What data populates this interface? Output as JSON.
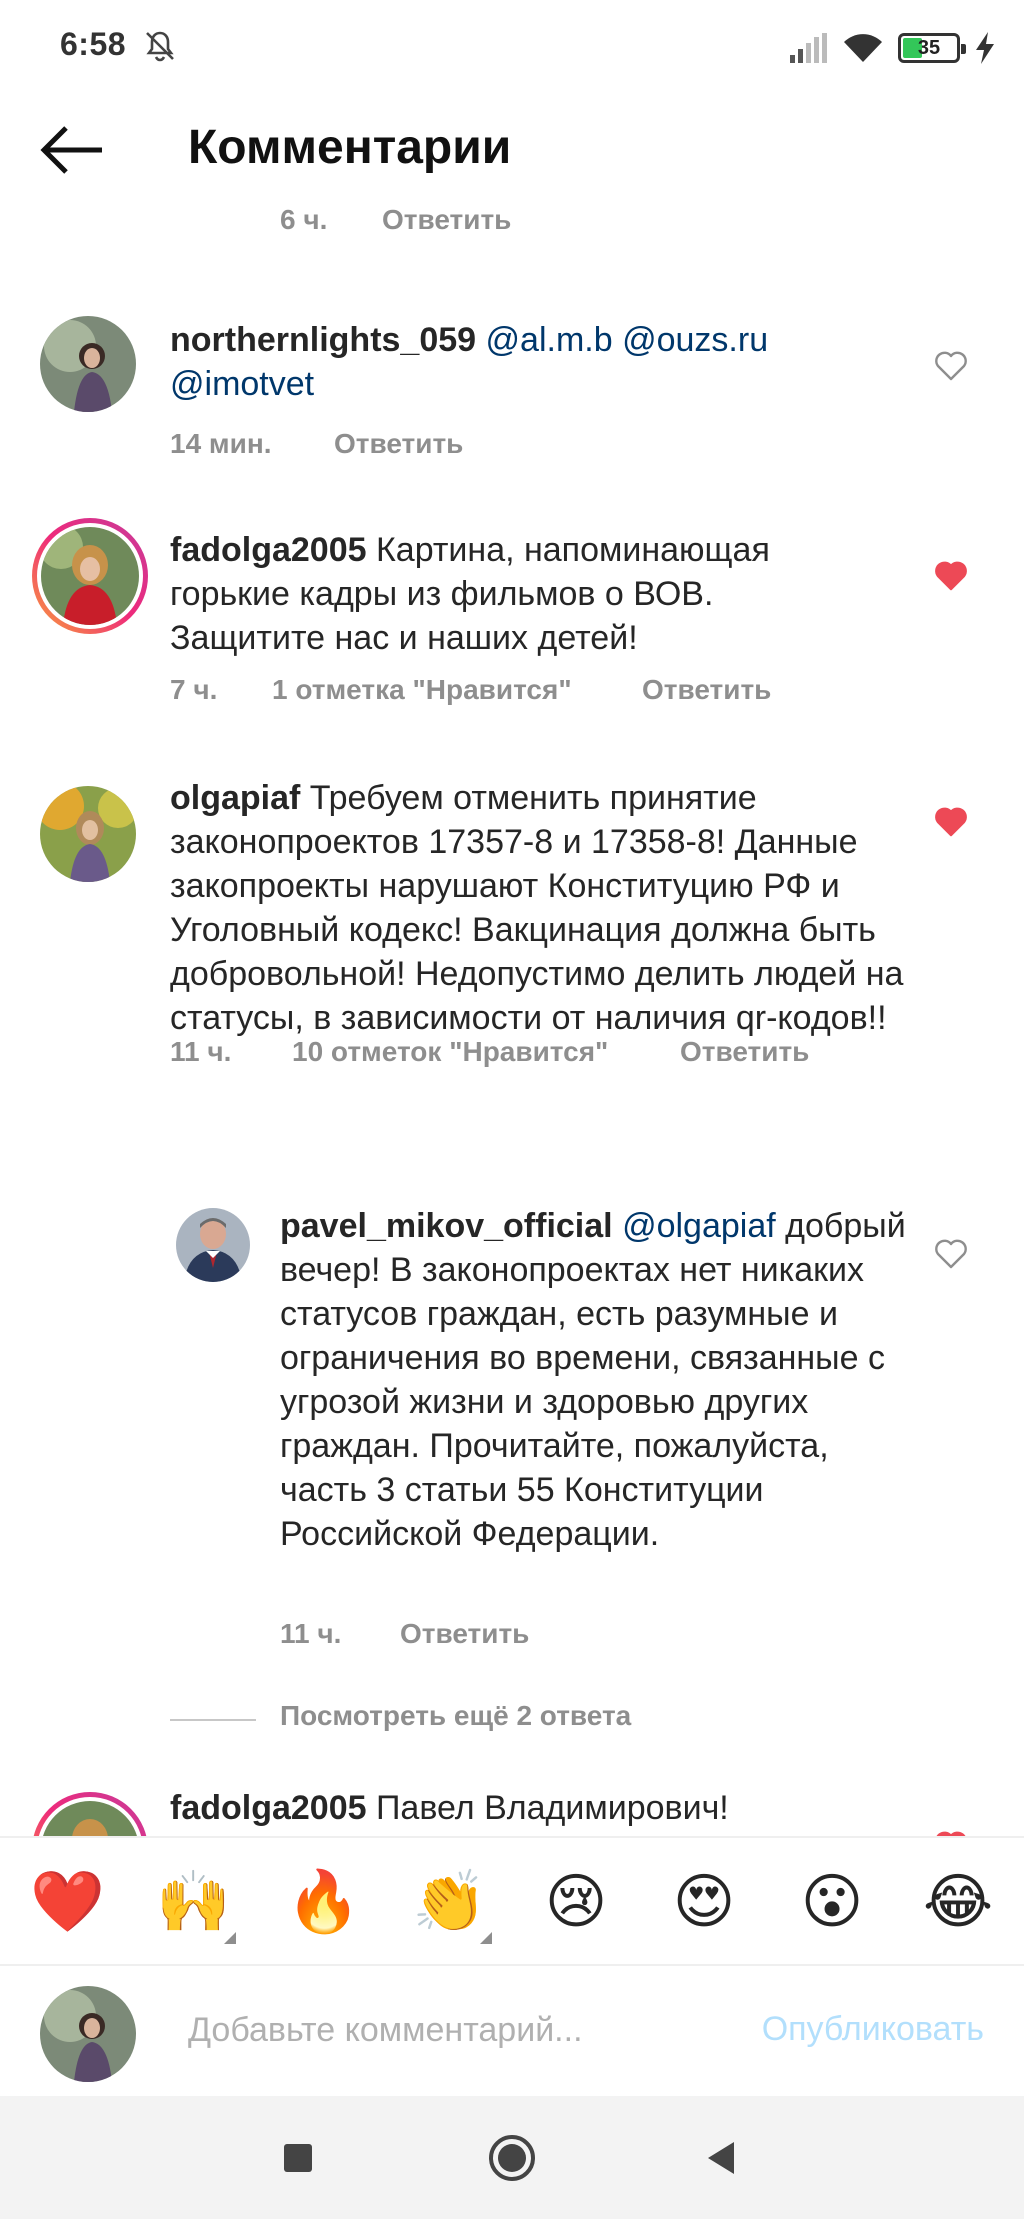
{
  "status_bar": {
    "time": "6:58",
    "battery": "35"
  },
  "header": {
    "title": "Комментарии"
  },
  "partial_comment": {
    "time": "6 ч.",
    "reply": "Ответить"
  },
  "comments": [
    {
      "username": "northernlights_059",
      "text_parts": [
        " ",
        "@al.m.b",
        " ",
        "@ouzs.ru",
        " ",
        "@imotvet"
      ],
      "time": "14 мин.",
      "likes": "",
      "reply": "Ответить",
      "liked": false
    },
    {
      "username": "fadolga2005",
      "text": " Картина, напоминающая горькие кадры из фильмов о ВОВ. Защитите нас и наших детей!",
      "time": "7 ч.",
      "likes": "1 отметка \"Нравится\"",
      "reply": "Ответить",
      "liked": true
    },
    {
      "username": "olgapiaf",
      "text": " Требуем отменить принятие законопроектов 17357-8 и 17358-8! Данные закопроекты нарушают Конституцию РФ и Уголовный кодекс! Вакцинация должна быть добровольной! Недопустимо делить людей на статусы, в зависимости от наличия qr-кодов!!",
      "time": "11 ч.",
      "likes": "10 отметок \"Нравится\"",
      "reply": "Ответить",
      "liked": true
    },
    {
      "username": "pavel_mikov_official",
      "mention": "@olgapiaf",
      "text": " добрый вечер! В законопроектах нет никаких статусов граждан, есть разумные и ограничения во времени, связанные с угрозой жизни и здоровью других граждан. Прочитайте, пожалуйста, часть 3 статьи 55 Конституции Российской Федерации.",
      "time": "11 ч.",
      "reply": "Ответить",
      "liked": false
    }
  ],
  "view_more_replies": "Посмотреть ещё 2 ответа",
  "last_comment": {
    "username": "fadolga2005",
    "text": " Павел Владимирович!"
  },
  "emoji_bar": [
    "❤️",
    "🙌",
    "🔥",
    "👏",
    "😢",
    "😍",
    "😮",
    "😂"
  ],
  "input": {
    "placeholder": "Добавьте комментарий...",
    "publish_label": "Опубликовать"
  },
  "colors": {
    "heart_liked": "#ed4956",
    "mention": "#00376b",
    "meta": "#8e8e8e",
    "publish_disabled": "#b2dffc"
  }
}
